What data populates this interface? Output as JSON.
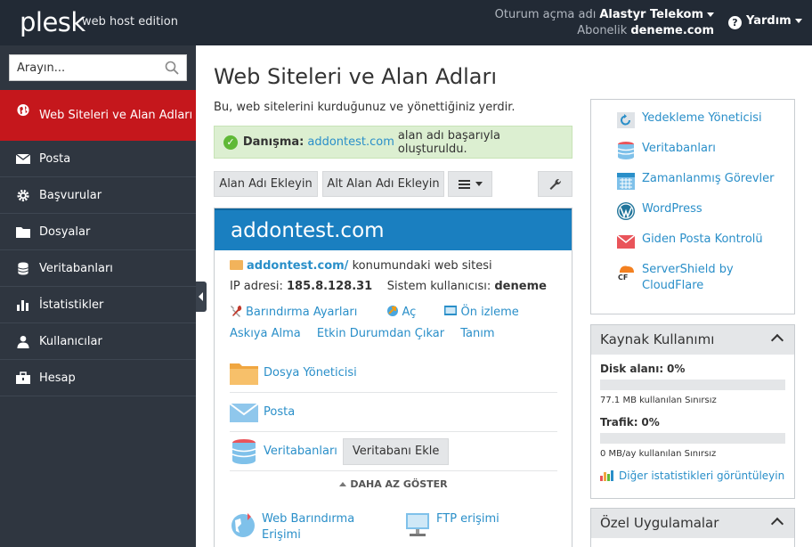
{
  "header": {
    "logo": "plesk",
    "edition": "web host edition",
    "login_label": "Oturum açma adı",
    "login_value": "Alastyr Telekom",
    "subscription_label": "Abonelik",
    "subscription_value": "deneme.com",
    "help_label": "Yardım"
  },
  "sidebar": {
    "search_placeholder": "Arayın...",
    "items": [
      {
        "label": "Web Siteleri ve Alan Adları",
        "icon": "globe-icon"
      },
      {
        "label": "Posta",
        "icon": "envelope-icon"
      },
      {
        "label": "Başvurular",
        "icon": "gear-icon"
      },
      {
        "label": "Dosyalar",
        "icon": "folder-icon"
      },
      {
        "label": "Veritabanları",
        "icon": "database-icon"
      },
      {
        "label": "İstatistikler",
        "icon": "bar-chart-icon"
      },
      {
        "label": "Kullanıcılar",
        "icon": "user-icon"
      },
      {
        "label": "Hesap",
        "icon": "briefcase-icon"
      }
    ]
  },
  "main": {
    "title": "Web Siteleri ve Alan Adları",
    "description": "Bu, web sitelerini kurduğunuz ve yönettiğiniz yerdir.",
    "alert": {
      "label": "Danışma:",
      "link": "addontest.com",
      "text": "alan adı başarıyla oluşturuldu."
    },
    "toolbar": {
      "add_domain": "Alan Adı Ekleyin",
      "add_subdomain": "Alt Alan Adı Ekleyin"
    },
    "domain": {
      "name": "addontest.com",
      "root_link": "addontest.com/",
      "root_text": "konumundaki web sitesi",
      "ip_label": "IP adresi:",
      "ip_value": "185.8.128.31",
      "sysuser_label": "Sistem kullanıcısı:",
      "sysuser_value": "deneme",
      "actions": {
        "hosting": "Barındırma Ayarları",
        "open": "Aç",
        "preview": "Ön izleme",
        "suspend": "Askıya Alma",
        "deactivate": "Etkin Durumdan Çıkar",
        "description": "Tanım"
      },
      "tools": {
        "file_manager": "Dosya Yöneticisi",
        "mail": "Posta",
        "databases": "Veritabanları",
        "add_database": "Veritabanı Ekle"
      },
      "show_less": "DAHA AZ GÖSTER",
      "web_hosting_access": "Web Barındırma Erişimi",
      "ftp_access": "FTP erişimi"
    }
  },
  "right": {
    "links": [
      {
        "label": "Yedekleme Yöneticisi",
        "icon": "backup-icon"
      },
      {
        "label": "Veritabanları",
        "icon": "database-icon"
      },
      {
        "label": "Zamanlanmış Görevler",
        "icon": "calendar-icon"
      },
      {
        "label": "WordPress",
        "icon": "wordpress-icon"
      },
      {
        "label": "Giden Posta Kontrolü",
        "icon": "outgoing-mail-icon"
      },
      {
        "label": "ServerShield by CloudFlare",
        "icon": "cloudflare-icon"
      }
    ],
    "resources": {
      "title": "Kaynak Kullanımı",
      "disk_label": "Disk alanı:",
      "disk_percent": "0%",
      "disk_detail": "77.1 MB kullanılan Sınırsız",
      "disk_fill": 0,
      "traffic_label": "Trafik:",
      "traffic_percent": "0%",
      "traffic_detail": "0 MB/ay kullanılan Sınırsız",
      "traffic_fill": 0,
      "more_link": "Diğer istatistikleri görüntüleyin"
    },
    "apps": {
      "title": "Özel Uygulamalar"
    }
  },
  "colors": {
    "header_bg": "#222a35",
    "sidebar_bg": "#2f3640",
    "active_item": "#c5171c",
    "domain_header": "#1a7fc0",
    "link": "#2a8fc9",
    "success_bg": "#dcefd1"
  }
}
